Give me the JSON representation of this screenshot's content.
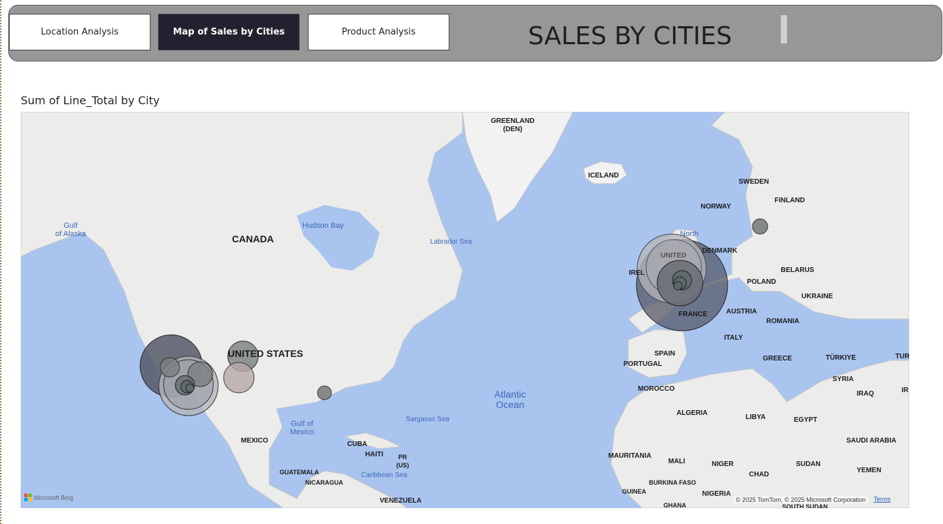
{
  "nav": {
    "location_label": "Location Analysis",
    "map_label": "Map of Sales by Cities",
    "product_label": "Product Analysis"
  },
  "header": {
    "title": "SALES BY CITIES"
  },
  "visual": {
    "title": "Sum of Line_Total by City"
  },
  "map_labels": {
    "greenland": "GREENLAND",
    "greenland_sub": "(DEN)",
    "iceland": "ICELAND",
    "sweden": "SWEDEN",
    "finland": "FINLAND",
    "norway": "NORWAY",
    "north": "North",
    "denmark": "DENMARK",
    "belarus": "BELARUS",
    "poland": "POLAND",
    "ukraine": "UKRAINE",
    "ireland": "IREL",
    "united_kingdom": "UNITED",
    "france": "FRANCE",
    "austria": "AUSTRIA",
    "romania": "ROMANIA",
    "italy": "ITALY",
    "spain": "SPAIN",
    "portugal": "PORTUGAL",
    "greece": "GREECE",
    "turkiye": "TÜRKIYE",
    "turkiye_cut": "TUR",
    "syria": "SYRIA",
    "iraq": "IRAQ",
    "iran_cut": "IR",
    "morocco": "MOROCCO",
    "algeria": "ALGERIA",
    "libya": "LIBYA",
    "egypt": "EGYPT",
    "saudi_arabia": "SAUDI ARABIA",
    "mauritania": "MAURITANIA",
    "mali": "MALI",
    "niger": "NIGER",
    "chad": "CHAD",
    "sudan": "SUDAN",
    "yemen": "YEMEN",
    "burkina_faso": "BURKINA FASO",
    "guinea": "GUINEA",
    "nigeria": "NIGERIA",
    "ghana": "GHANA",
    "south_sudan": "SOUTH SUDAN",
    "canada": "CANADA",
    "united_states": "UNITED STATES",
    "mexico": "MEXICO",
    "cuba": "CUBA",
    "haiti": "HAITI",
    "pr": "PR",
    "pr_sub": "(US)",
    "guatemala": "GUATEMALA",
    "nicaragua": "NICARAGUA",
    "venezuela": "VENEZUELA",
    "gulf_alaska": "Gulf",
    "gulf_alaska_2": "of Alaska",
    "hudson_bay": "Hudson Bay",
    "labrador_sea": "Labrador Sea",
    "atlantic": "Atlantic",
    "atlantic_2": "Ocean",
    "sargasso": "Sargasso Sea",
    "gulf_mexico": "Gulf of",
    "gulf_mexico_2": "Mexico",
    "caribbean": "Caribbean Sea"
  },
  "map_footer": {
    "bing": "Microsoft Bing",
    "copyright": "© 2025 TomTom, © 2025 Microsoft Corporation",
    "terms": "Terms"
  },
  "colors": {
    "header_bg": "#979797",
    "nav_active_bg": "#222130",
    "water": "#a9c4ef",
    "land": "#ececea",
    "bubble_dark": "#555a68",
    "bubble_mid": "#7b8080",
    "bubble_light": "#b5b5bb",
    "bubble_pink": "#b8a8a8"
  }
}
